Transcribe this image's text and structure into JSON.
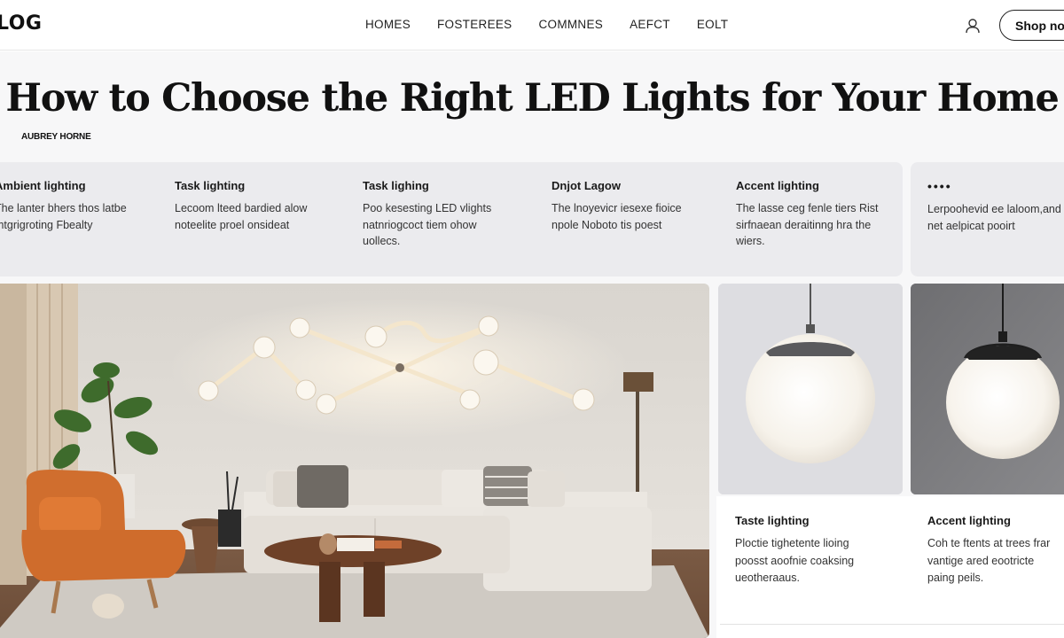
{
  "header": {
    "logo": "LOG",
    "nav": [
      "HOMES",
      "FOSTEREES",
      "COMMNES",
      "AEFCT",
      "EOLT"
    ],
    "shop_button": "Shop now"
  },
  "article": {
    "title": "How to Choose the Right LED Lights for Your Home",
    "author": "AUBREY HORNE"
  },
  "categories": [
    {
      "title": "Ambient lighting",
      "desc": "The lanter bhers thos latbe\nmtgrigroting Fbealty"
    },
    {
      "title": "Task lighting",
      "desc": "Lecoom lteed bardied alow\nnoteelite proel onsideat"
    },
    {
      "title": "Task lighing",
      "desc": "Poo kesesting LED vlights\nnatnriogcoct tiem ohow\nuollecs."
    },
    {
      "title": "Dnjot Lagow",
      "desc": "The lnoyevicr iesexe fioice\nnpole Noboto tis poest"
    },
    {
      "title": "Accent lighting",
      "desc": "The lasse ceg fenle tiers Rist\nsirfnaean deraitinng hra the\nwiers."
    },
    {
      "title": "••••",
      "desc": "Lerpoohevid ee laloom,and\nnet aelpicat pooirt"
    }
  ],
  "products": [
    {
      "title": "Taste lighting",
      "desc": "Ploctie tighetente lioing\npoosst aoofnie coaksing\nueotheraaus."
    },
    {
      "title": "Accent lighting",
      "desc": "Coh te ftents at trees frar\nvantige ared eootricte\npaing peils."
    }
  ],
  "colors": {
    "page_bg": "#f7f7f8",
    "strip_bg": "#ebebee",
    "wall": "#dedad4",
    "sofa": "#e8e4de",
    "armchair": "#d06e2e"
  },
  "icons": [
    "user-icon"
  ]
}
